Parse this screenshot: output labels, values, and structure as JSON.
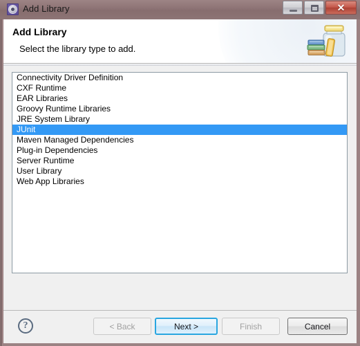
{
  "window": {
    "title": "Add Library",
    "title_icon": "gear-icon",
    "controls": {
      "minimize": "minimize-icon",
      "maximize": "restore-icon",
      "close": "✕"
    }
  },
  "header": {
    "title": "Add Library",
    "subtitle": "Select the library type to add.",
    "icon": "jar-of-books-icon"
  },
  "library_list": {
    "selected_index": 5,
    "items": [
      "Connectivity Driver Definition",
      "CXF Runtime",
      "EAR Libraries",
      "Groovy Runtime Libraries",
      "JRE System Library",
      "JUnit",
      "Maven Managed Dependencies",
      "Plug-in Dependencies",
      "Server Runtime",
      "User Library",
      "Web App Libraries"
    ]
  },
  "footer": {
    "help_label": "?",
    "buttons": [
      {
        "label": "< Back",
        "state": "disabled"
      },
      {
        "label": "Next >",
        "state": "default"
      },
      {
        "label": "Finish",
        "state": "disabled"
      },
      {
        "label": "Cancel",
        "state": "normal"
      }
    ]
  },
  "colors": {
    "titlebar": "#8a7071",
    "selection": "#3399f5",
    "default_button_border": "#29a6e0",
    "dialog_background": "#f0f0f0"
  }
}
